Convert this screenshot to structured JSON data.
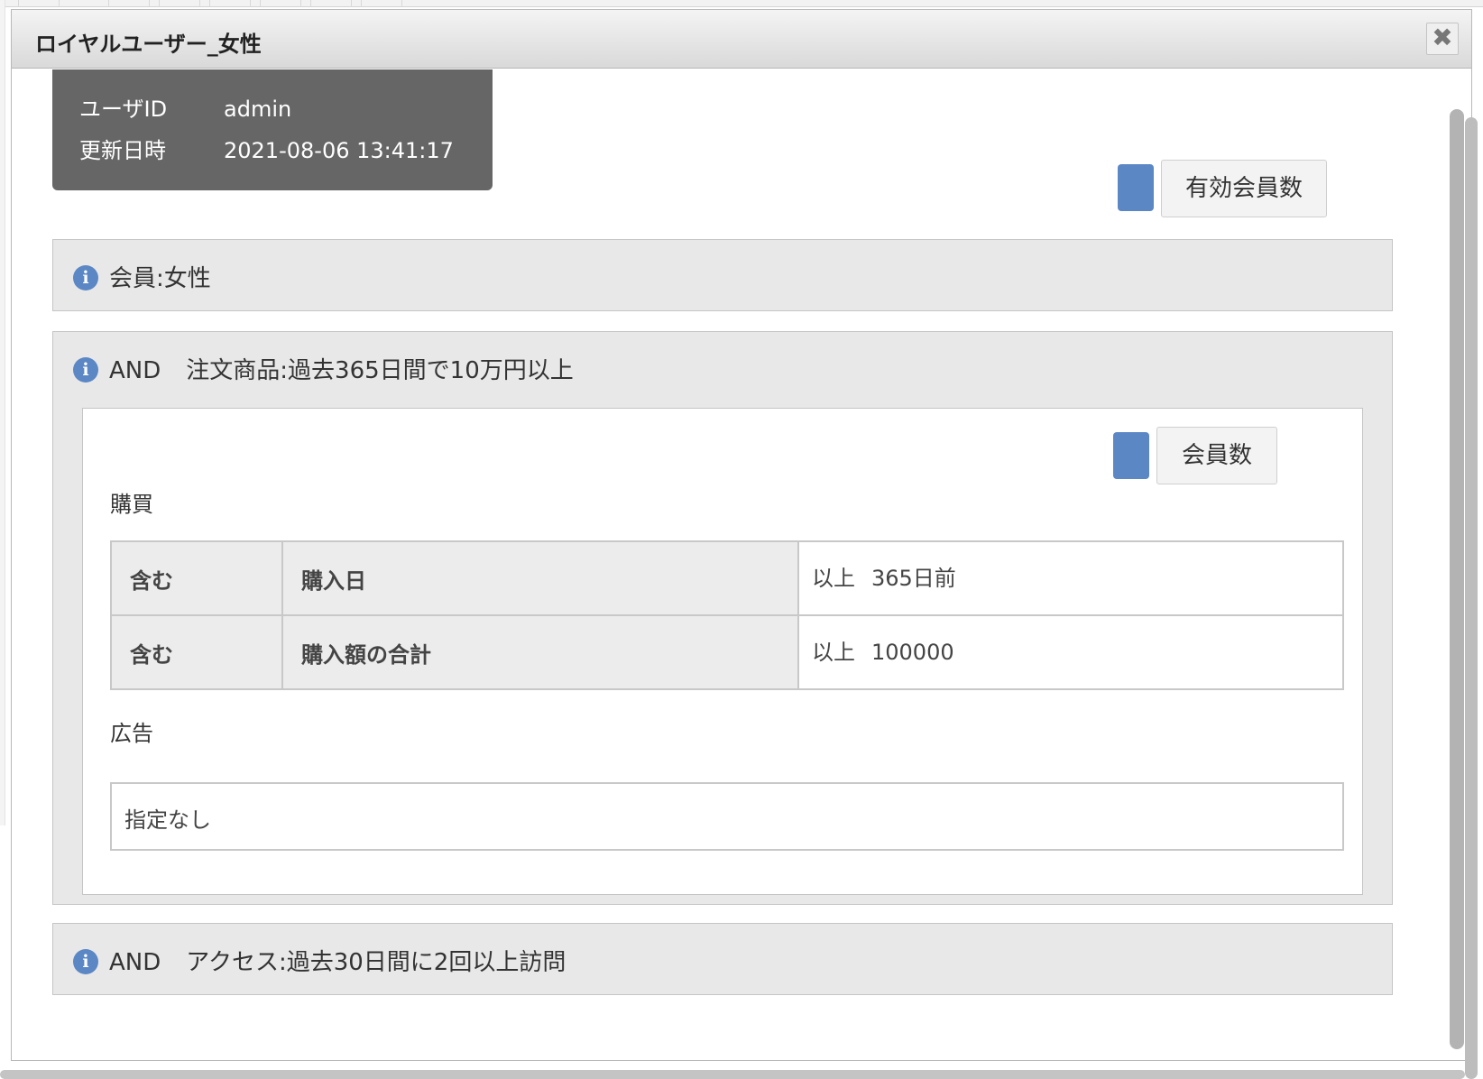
{
  "dialog": {
    "title": "ロイヤルユーザー_女性",
    "close_glyph": "✖"
  },
  "meta": {
    "user_id_label": "ユーザID",
    "user_id_value": "admin",
    "updated_label": "更新日時",
    "updated_value": "2021-08-06 13:41:17"
  },
  "top_count_button": {
    "label": "有効会員数",
    "swatch_color": "#5b87c5"
  },
  "conditions": [
    {
      "icon": "info-icon",
      "prefix": "",
      "text": "会員:女性"
    },
    {
      "icon": "info-icon",
      "prefix": "AND",
      "text": "注文商品:過去365日間で10万円以上"
    },
    {
      "icon": "info-icon",
      "prefix": "AND",
      "text": "アクセス:過去30日間に2回以上訪問"
    }
  ],
  "detail": {
    "count_button": {
      "label": "会員数",
      "swatch_color": "#5b87c5"
    },
    "purchase_label": "購買",
    "rows": [
      {
        "include": "含む",
        "field": "購入日",
        "op": "以上",
        "value": "365日前"
      },
      {
        "include": "含む",
        "field": "購入額の合計",
        "op": "以上",
        "value": "100000"
      }
    ],
    "ad_label": "広告",
    "ad_value": "指定なし"
  }
}
